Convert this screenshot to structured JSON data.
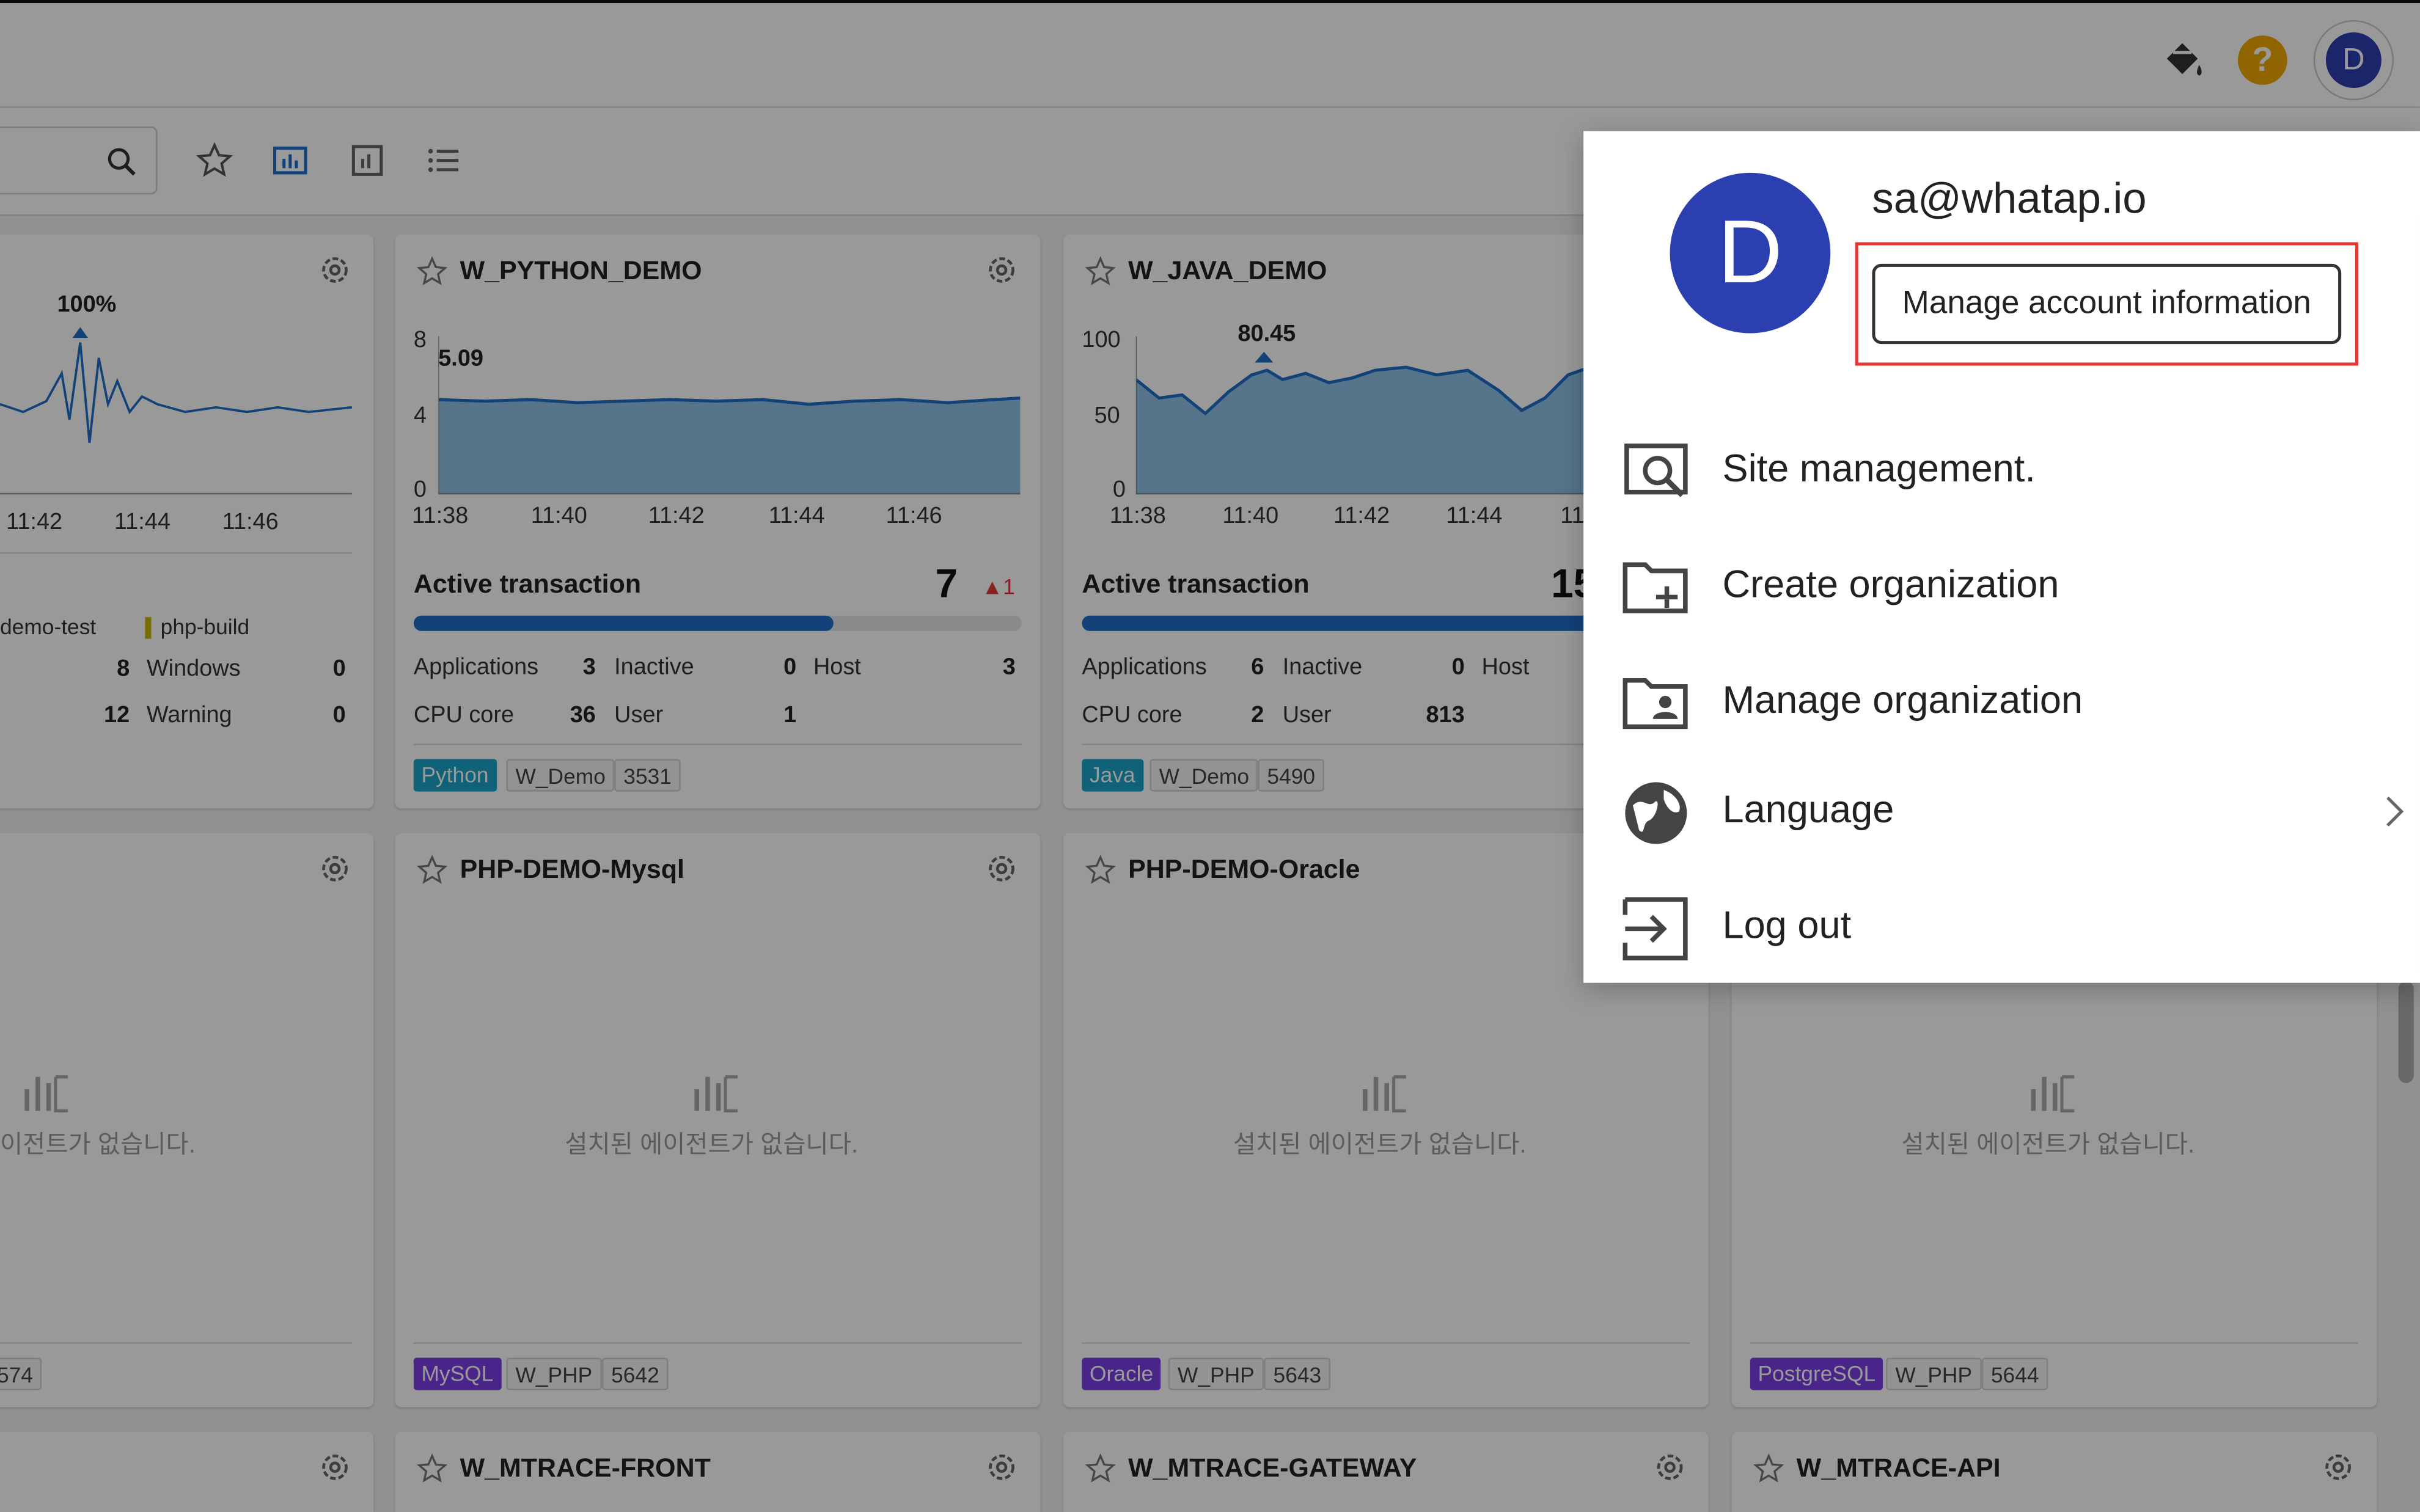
{
  "topbar": {
    "help_label": "?",
    "avatar_initial": "D"
  },
  "account_menu": {
    "avatar_initial": "D",
    "email": "sa@whatap.io",
    "manage_account_label": "Manage account information",
    "items": [
      {
        "label": "Site management."
      },
      {
        "label": "Create organization"
      },
      {
        "label": "Manage organization"
      },
      {
        "label": "Language"
      },
      {
        "label": "Log out"
      }
    ]
  },
  "cards": {
    "partial_top": {
      "peak": "100%",
      "x_ticks": [
        "11:42",
        "11:44",
        "11:46"
      ],
      "legend": [
        "demo-test",
        "php-build"
      ],
      "stat_row1": {
        "value": "8",
        "label": "Windows",
        "value2": "0"
      },
      "stat_row2": {
        "value": "12",
        "label": "Warning",
        "value2": "0"
      }
    },
    "python": {
      "title": "W_PYTHON_DEMO",
      "y_ticks": [
        "8",
        "4",
        "0"
      ],
      "peak": "5.09",
      "x_ticks": [
        "11:38",
        "11:40",
        "11:42",
        "11:44",
        "11:46"
      ],
      "active_label": "Active transaction",
      "active_count": "7",
      "active_delta": "▲1",
      "active_ratio": 0.69,
      "applications_label": "Applications",
      "applications": "3",
      "inactive_label": "Inactive",
      "inactive": "0",
      "host_label": "Host",
      "host": "3",
      "cpu_label": "CPU core",
      "cpu": "36",
      "user_label": "User",
      "user": "1",
      "tags": [
        "Python",
        "W_Demo",
        "3531"
      ]
    },
    "java": {
      "title": "W_JAVA_DEMO",
      "y_ticks": [
        "100",
        "50",
        "0"
      ],
      "peak": "80.45",
      "x_ticks": [
        "11:38",
        "11:40",
        "11:42",
        "11:44",
        "11"
      ],
      "active_label": "Active transaction",
      "active_count": "15",
      "applications_label": "Applications",
      "applications": "6",
      "inactive_label": "Inactive",
      "inactive": "0",
      "host_label": "Host",
      "cpu_label": "CPU core",
      "cpu": "2",
      "user_label": "User",
      "user": "813",
      "tags": [
        "Java",
        "W_Demo",
        "5490"
      ]
    },
    "partial_mid": {
      "empty_msg": "이전트가 없습니다.",
      "tag": "574"
    },
    "mysql": {
      "title": "PHP-DEMO-Mysql",
      "empty_msg": "설치된 에이전트가 없습니다.",
      "tags": [
        "MySQL",
        "W_PHP",
        "5642"
      ]
    },
    "oracle": {
      "title": "PHP-DEMO-Oracle",
      "empty_msg": "설치된 에이전트가 없습니다.",
      "tags": [
        "Oracle",
        "W_PHP",
        "5643"
      ]
    },
    "postgres": {
      "empty_msg": "설치된 에이전트가 없습니다.",
      "tags": [
        "PostgreSQL",
        "W_PHP",
        "5644"
      ]
    },
    "front": {
      "title": "W_MTRACE-FRONT"
    },
    "gateway": {
      "title": "W_MTRACE-GATEWAY"
    },
    "api": {
      "title": "W_MTRACE-API"
    }
  },
  "colors": {
    "accent_blue": "#1e6fc8",
    "avatar": "#2c3fb1",
    "python_tag": "#1aa3c8",
    "java_tag": "#1aa3c8",
    "mysql_tag": "#7b3fe4",
    "oracle_tag": "#7b3fe4",
    "postgres_tag": "#7b3fe4",
    "highlight_red": "#e53935"
  }
}
